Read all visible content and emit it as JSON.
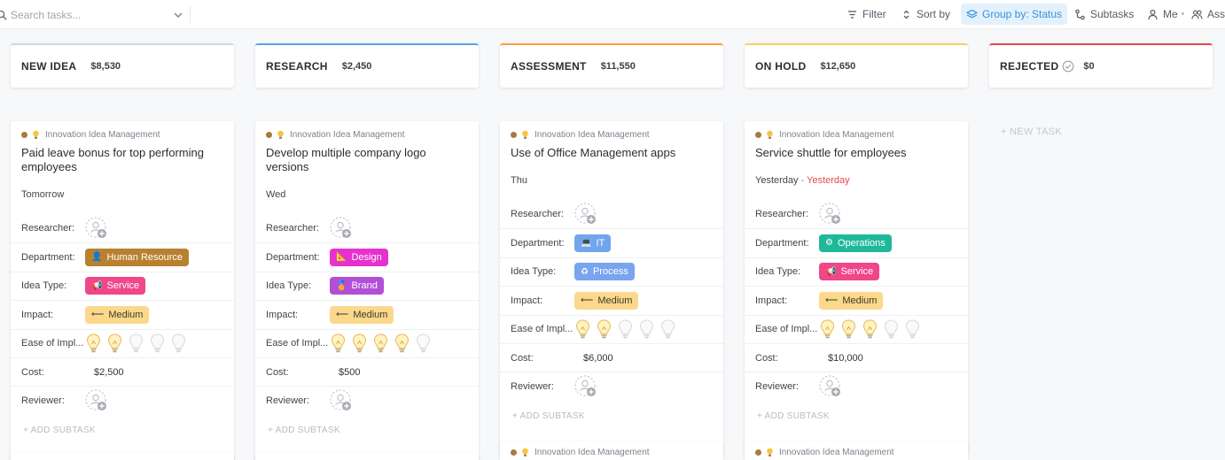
{
  "toolbar": {
    "search_placeholder": "Search tasks...",
    "filter": "Filter",
    "sort_by": "Sort by",
    "group_by": "Group by: Status",
    "subtasks": "Subtasks",
    "me": "Me",
    "assignees": "Assi"
  },
  "columns": [
    {
      "title": "NEW IDEA",
      "total": "$8,530",
      "color": "#d3d6db"
    },
    {
      "title": "RESEARCH",
      "total": "$2,450",
      "color": "#5aa2e8"
    },
    {
      "title": "ASSESSMENT",
      "total": "$11,550",
      "color": "#f6a040"
    },
    {
      "title": "ON HOLD",
      "total": "$12,650",
      "color": "#f7cf5b"
    },
    {
      "title": "REJECTED",
      "total": "$0",
      "color": "#e5484d"
    }
  ],
  "labels": {
    "list_name": "Innovation Idea Management",
    "researcher": "Researcher:",
    "department": "Department:",
    "idea_type": "Idea Type:",
    "impact": "Impact:",
    "ease": "Ease of Impl...",
    "cost": "Cost:",
    "reviewer": "Reviewer:",
    "add_subtask": "+ ADD SUBTASK",
    "new_task": "+ NEW TASK"
  },
  "cards": [
    {
      "title": "Paid leave bonus for top performing employees",
      "date": "Tomorrow",
      "date_extra": "",
      "dept": "Human Resource",
      "dept_icon": "👤",
      "dept_color": "#b7812f",
      "idea": "Service",
      "idea_icon": "📢",
      "idea_color": "#f0468a",
      "impact": "Medium",
      "impact_icon": "⟵",
      "ease": 2,
      "cost": "$2,500"
    },
    {
      "title": "Develop multiple company logo versions",
      "date": "Wed",
      "date_extra": "",
      "dept": "Design",
      "dept_icon": "📐",
      "dept_color": "#e631cf",
      "idea": "Brand",
      "idea_icon": "🏅",
      "idea_color": "#b14fd6",
      "impact": "Medium",
      "impact_icon": "⟵",
      "ease": 4,
      "cost": "$500"
    },
    {
      "title": "Use of Office Management apps",
      "date": "Thu",
      "date_extra": "",
      "dept": "IT",
      "dept_icon": "💻",
      "dept_color": "#6fa6ee",
      "idea": "Process",
      "idea_icon": "♻",
      "idea_color": "#79a4ee",
      "impact": "Medium",
      "impact_icon": "⟵",
      "ease": 2,
      "cost": "$6,000"
    },
    {
      "title": "Service shuttle for employees",
      "date": "Yesterday",
      "date_extra": "Yesterday",
      "dept": "Operations",
      "dept_icon": "⚙",
      "dept_color": "#1fb99a",
      "idea": "Service",
      "idea_icon": "📢",
      "idea_color": "#f0468a",
      "impact": "Medium",
      "impact_icon": "⟵",
      "ease": 3,
      "cost": "$10,000"
    }
  ]
}
